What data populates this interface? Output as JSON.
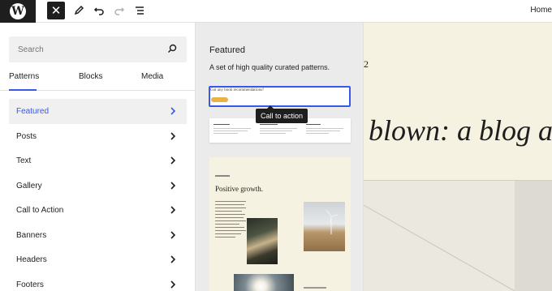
{
  "toolbar": {
    "home_label": "Home"
  },
  "sidebar": {
    "search_placeholder": "Search",
    "tabs": [
      {
        "label": "Patterns",
        "active": true
      },
      {
        "label": "Blocks",
        "active": false
      },
      {
        "label": "Media",
        "active": false
      }
    ],
    "categories": [
      {
        "label": "Featured",
        "active": true
      },
      {
        "label": "Posts"
      },
      {
        "label": "Text"
      },
      {
        "label": "Gallery"
      },
      {
        "label": "Call to Action"
      },
      {
        "label": "Banners"
      },
      {
        "label": "Headers"
      },
      {
        "label": "Footers"
      }
    ]
  },
  "pattern_panel": {
    "title": "Featured",
    "description": "A set of high quality curated patterns.",
    "pattern1_text": "Got any book recommendations?",
    "tooltip": "Call to action",
    "pattern3_heading": "Positive growth."
  },
  "preview": {
    "number": "2",
    "heading": "blown: a blog ab"
  },
  "colors": {
    "accent": "#3858e9",
    "dark": "#1e1e1e",
    "preview_bg": "#f6f2e2"
  }
}
